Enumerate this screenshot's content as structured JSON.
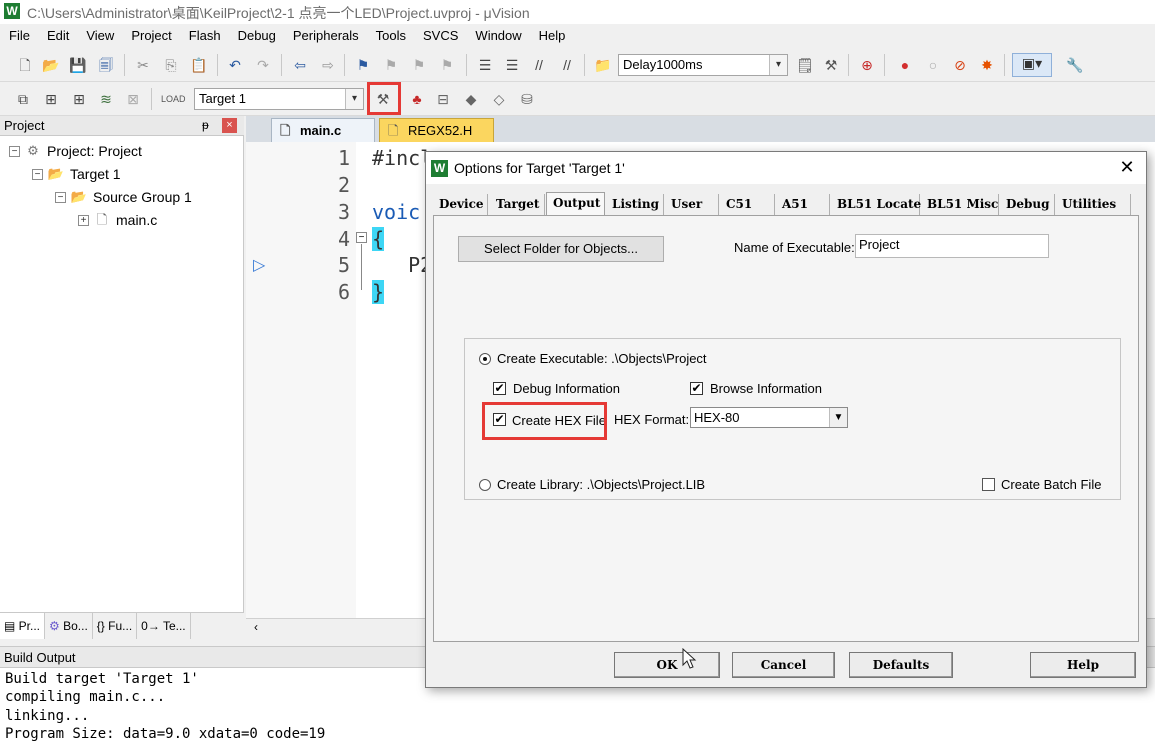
{
  "window": {
    "title": "C:\\Users\\Administrator\\桌面\\KeilProject\\2-1 点亮一个LED\\Project.uvproj - μVision",
    "app_icon": "W"
  },
  "menu": [
    "File",
    "Edit",
    "View",
    "Project",
    "Flash",
    "Debug",
    "Peripherals",
    "Tools",
    "SVCS",
    "Window",
    "Help"
  ],
  "toolbar": {
    "function_combo": "Delay1000ms",
    "target_combo": "Target 1"
  },
  "project_panel": {
    "title": "Project",
    "pin": "ᵽ",
    "close": "×",
    "tree": {
      "root": "Project: Project",
      "target": "Target 1",
      "group": "Source Group 1",
      "file": "main.c"
    },
    "tabs": [
      "Pr...",
      "Bo...",
      "{} Fu...",
      "0→ Te..."
    ]
  },
  "editor": {
    "tabs": [
      "main.c",
      "REGX52.H"
    ],
    "lines": [
      {
        "n": "1",
        "text": "#incl"
      },
      {
        "n": "2",
        "text": ""
      },
      {
        "n": "3",
        "text": "voic"
      },
      {
        "n": "4",
        "text": "{"
      },
      {
        "n": "5",
        "text": "   P2"
      },
      {
        "n": "6",
        "text": "}"
      }
    ]
  },
  "build_output": {
    "title": "Build Output",
    "lines": [
      "Build target 'Target 1'",
      "compiling main.c...",
      "linking...",
      "Program Size: data=9.0 xdata=0 code=19"
    ]
  },
  "dialog": {
    "icon": "W",
    "title": "Options for Target 'Target 1'",
    "close": "✕",
    "tabs": [
      "Device",
      "Target",
      "Output",
      "Listing",
      "User",
      "C51",
      "A51",
      "BL51 Locate",
      "BL51 Misc",
      "Debug",
      "Utilities"
    ],
    "active_tab": "Output",
    "select_folder_button": "Select Folder for Objects...",
    "name_label": "Name of Executable:",
    "name_value": "Project",
    "create_executable": "Create Executable:  .\\Objects\\Project",
    "debug_info": "Debug Information",
    "browse_info": "Browse Information",
    "create_hex": "Create HEX File",
    "hex_format_label": "HEX Format:",
    "hex_format_value": "HEX-80",
    "create_library": "Create Library:  .\\Objects\\Project.LIB",
    "create_batch": "Create Batch File",
    "buttons": {
      "ok": "OK",
      "cancel": "Cancel",
      "defaults": "Defaults",
      "help": "Help"
    }
  },
  "colors": {
    "highlight": "#e53935",
    "regx_tab": "#fbd65f",
    "bracket_highlight": "#3dd6f5"
  }
}
